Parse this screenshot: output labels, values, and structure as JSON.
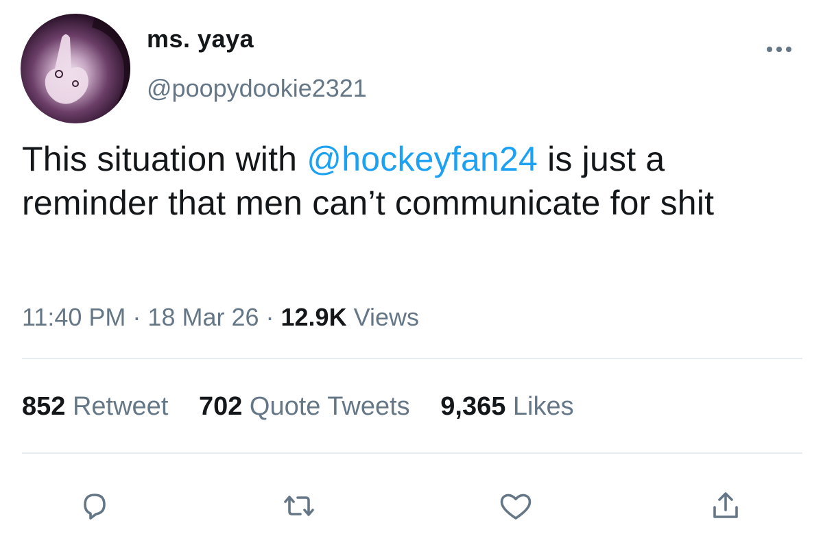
{
  "author": {
    "display_name": "ms. yaya",
    "handle": "@poopydookie2321"
  },
  "tweet": {
    "text_before": "This situation with ",
    "mention": "@hockeyfan24",
    "text_after": " is just a reminder that men can’t communicate for shit"
  },
  "meta": {
    "time": "11:40 PM",
    "separator": "·",
    "date": "18 Mar 26",
    "views_count": "12.9K",
    "views_label": "Views"
  },
  "stats": {
    "retweets_count": "852",
    "retweets_label": "Retweet",
    "quotes_count": "702",
    "quotes_label": "Quote Tweets",
    "likes_count": "9,365",
    "likes_label": "Likes"
  },
  "icons": {
    "more": "more-dots-icon",
    "reply": "reply-icon",
    "retweet": "retweet-icon",
    "like": "like-heart-icon",
    "share": "share-icon"
  },
  "colors": {
    "text": "#14171a",
    "secondary": "#657786",
    "mention": "#1da1f2",
    "divider": "#e6ecf0",
    "icon": "#657786"
  }
}
